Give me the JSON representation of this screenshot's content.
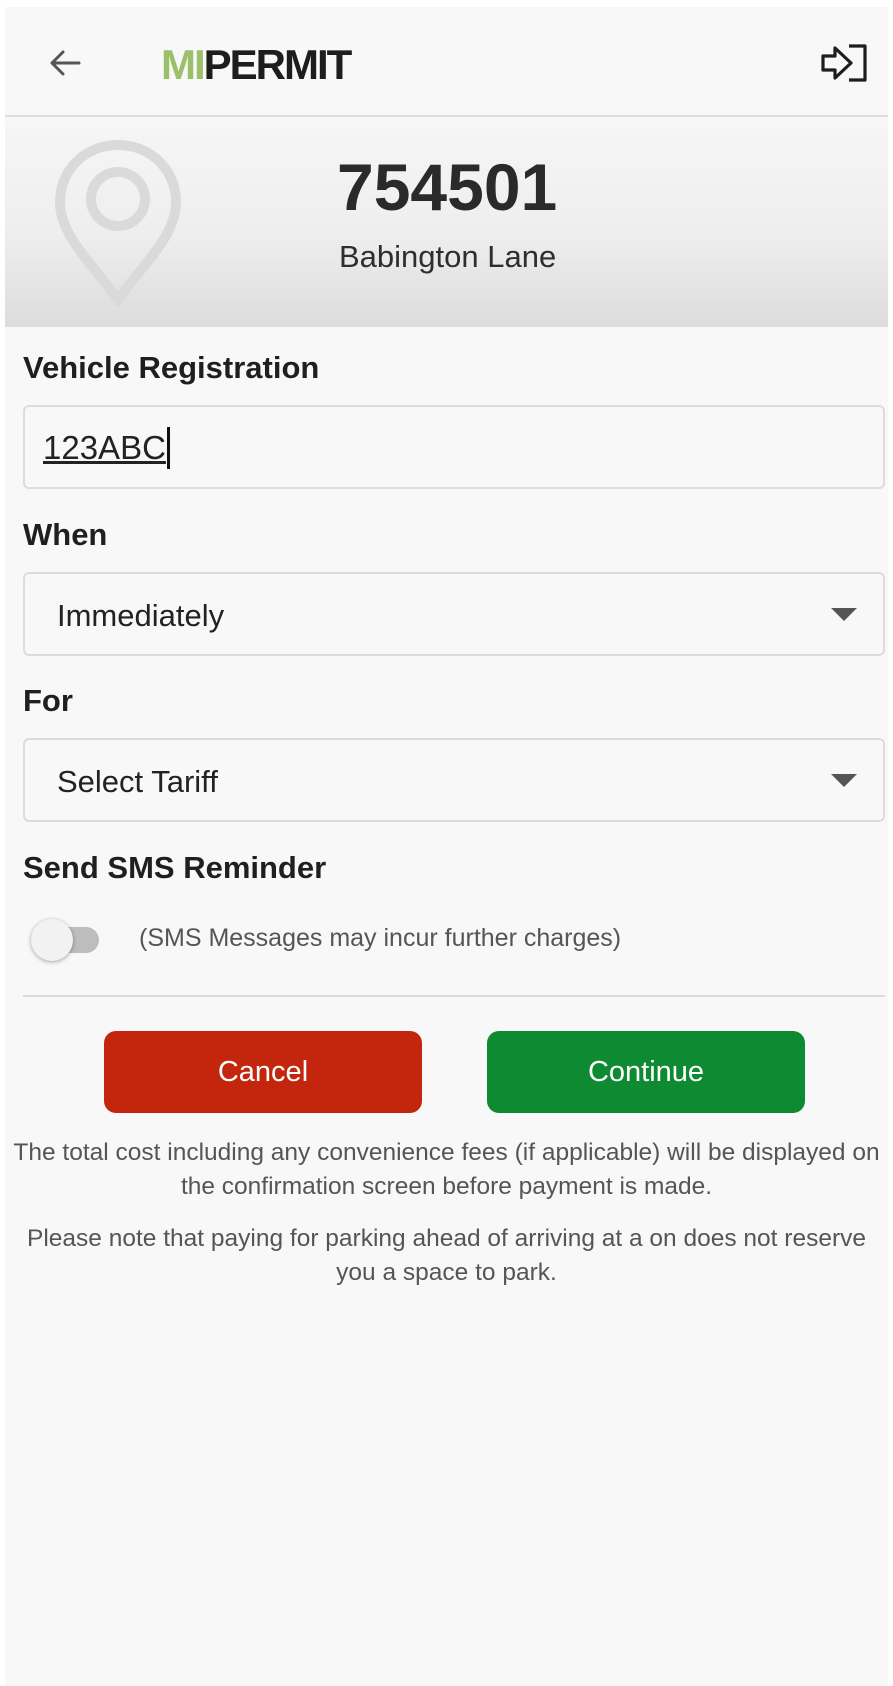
{
  "header": {
    "logo_mi": "MI",
    "logo_permit": "PERMIT",
    "back_icon": "arrow-left-icon",
    "logout_icon": "logout-icon"
  },
  "location": {
    "code": "754501",
    "name": "Babington Lane",
    "icon": "map-pin-icon"
  },
  "form": {
    "vehicle_label": "Vehicle Registration",
    "vehicle_value": "123ABC",
    "when_label": "When",
    "when_value": "Immediately",
    "for_label": "For",
    "for_value": "Select Tariff",
    "sms_label": "Send SMS Reminder",
    "sms_enabled": false,
    "sms_note": "(SMS Messages may incur further charges)"
  },
  "actions": {
    "cancel_label": "Cancel",
    "continue_label": "Continue"
  },
  "info": {
    "line1": "The total cost including any convenience fees (if applicable) will be displayed on",
    "line2": "the confirmation screen before payment is made.",
    "line3": "Please note that paying for parking ahead of arriving at a on does not reserve",
    "line4": "you a space to park."
  },
  "colors": {
    "logo_mi": "#9cc06a",
    "cancel": "#c3260c",
    "continue": "#0e8a32"
  }
}
